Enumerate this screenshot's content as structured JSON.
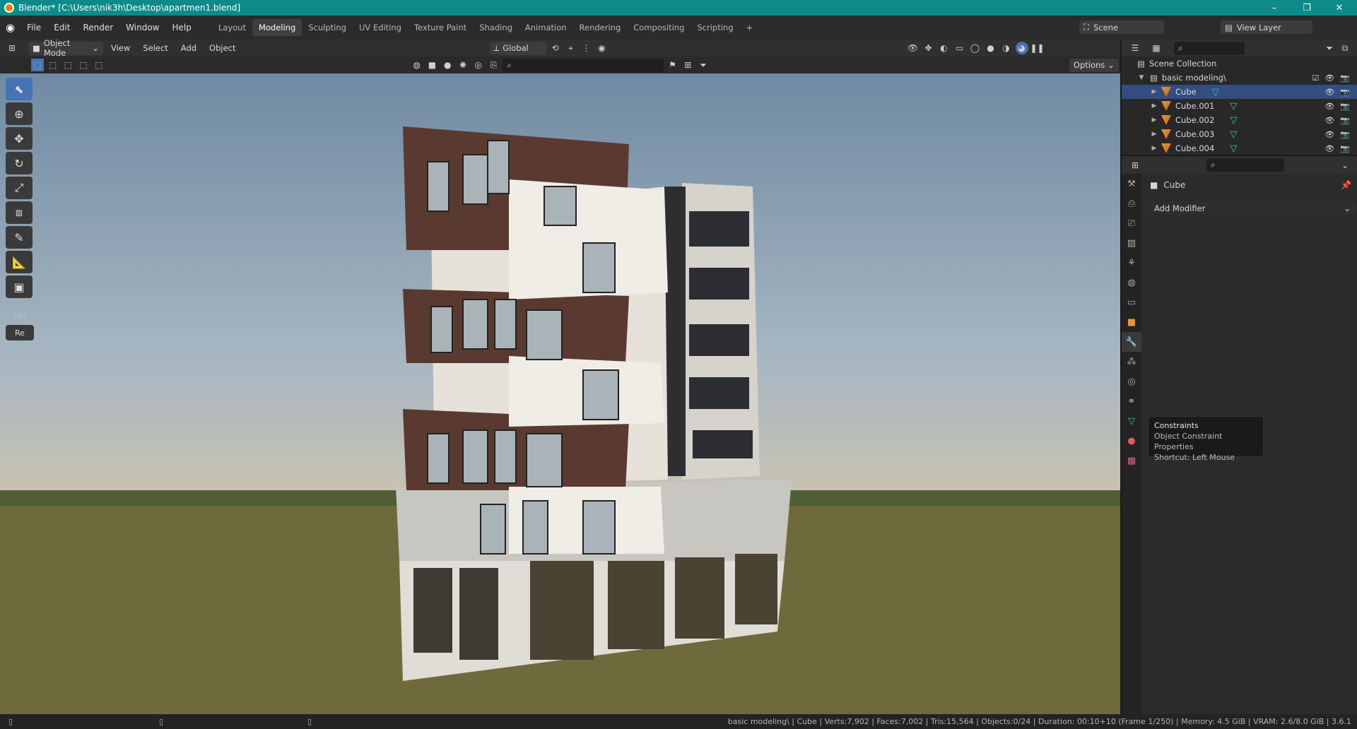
{
  "title": "Blender* [C:\\Users\\nik3h\\Desktop\\apartmen1.blend]",
  "window_controls": [
    "–",
    "❐",
    "✕"
  ],
  "menu": [
    "File",
    "Edit",
    "Render",
    "Window",
    "Help"
  ],
  "workspaces": [
    "Layout",
    "Modeling",
    "Sculpting",
    "UV Editing",
    "Texture Paint",
    "Shading",
    "Animation",
    "Rendering",
    "Compositing",
    "Scripting",
    "+"
  ],
  "active_workspace": "Modeling",
  "scene": {
    "name": "Scene",
    "view_layer": "View Layer"
  },
  "header": {
    "mode": "Object Mode",
    "view": "View",
    "select": "Select",
    "add": "Add",
    "object": "Object",
    "transform": "Global",
    "options": "Options"
  },
  "toolbar_panel": {
    "label": "Laz",
    "button": "Re"
  },
  "outliner": {
    "root": "Scene Collection",
    "collection": "basic modeling\\",
    "objects": [
      "Cube",
      "Cube.001",
      "Cube.002",
      "Cube.003",
      "Cube.004"
    ]
  },
  "properties": {
    "object": "Cube",
    "add_modifier": "Add Modifier"
  },
  "tooltip": {
    "title": "Constraints",
    "desc": "Object Constraint Properties",
    "shortcut": "Shortcut: Left Mouse"
  },
  "status": "basic modeling\\ | Cube | Verts:7,902 | Faces:7,002 | Tris:15,564 | Objects:0/24 | Duration: 00:10+10 (Frame 1/250) | Memory: 4.5 GiB | VRAM: 2.6/8.0 GiB | 3.6.1",
  "colors": {
    "accent": "#4772b3",
    "titlebar": "#0e8a8a",
    "object": "#e8963f",
    "mesh": "#3fcf7f"
  }
}
